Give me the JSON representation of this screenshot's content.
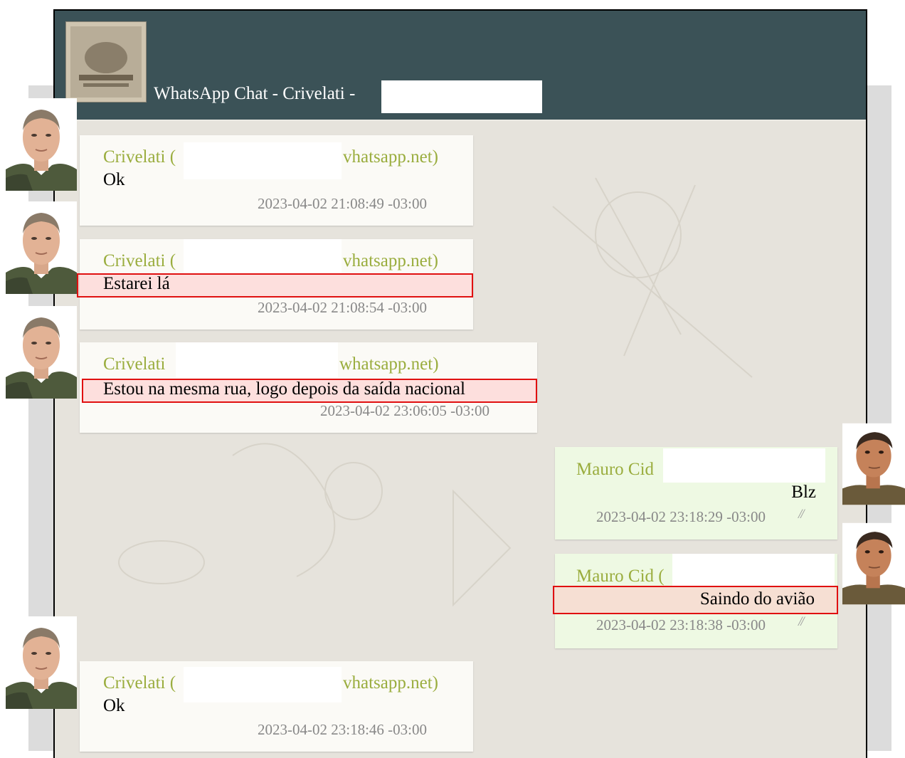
{
  "header": {
    "title": "WhatsApp Chat - Crivelati -"
  },
  "messages": [
    {
      "direction": "in",
      "sender": "Crivelati (",
      "sender_domain": "vhatsapp.net)",
      "text": "Ok",
      "timestamp": "2023-04-02 21:08:49 -03:00",
      "highlighted": false
    },
    {
      "direction": "in",
      "sender": "Crivelati (",
      "sender_domain": "vhatsapp.net)",
      "text": "Estarei lá",
      "timestamp": "2023-04-02 21:08:54 -03:00",
      "highlighted": true
    },
    {
      "direction": "in",
      "sender": "Crivelati",
      "sender_domain": "whatsapp.net)",
      "text": "Estou na mesma rua, logo depois da saída nacional",
      "timestamp": "2023-04-02 23:06:05 -03:00",
      "highlighted": true
    },
    {
      "direction": "out",
      "sender": "Mauro Cid",
      "text": "Blz",
      "timestamp": "2023-04-02 23:18:29 -03:00",
      "ticks": "//",
      "highlighted": false
    },
    {
      "direction": "out",
      "sender": "Mauro Cid (",
      "text": "Saindo do avião",
      "timestamp": "2023-04-02 23:18:38 -03:00",
      "ticks": "//",
      "highlighted": true
    },
    {
      "direction": "in",
      "sender": "Crivelati (",
      "sender_domain": "vhatsapp.net)",
      "text": "Ok",
      "timestamp": "2023-04-02 23:18:46 -03:00",
      "highlighted": false
    }
  ],
  "colors": {
    "header_bg": "#3b5257",
    "sender_name": "#9aad3e",
    "highlight_border": "#e01010"
  },
  "avatars": [
    "crivelati-avatar",
    "mauro-cid-avatar"
  ]
}
